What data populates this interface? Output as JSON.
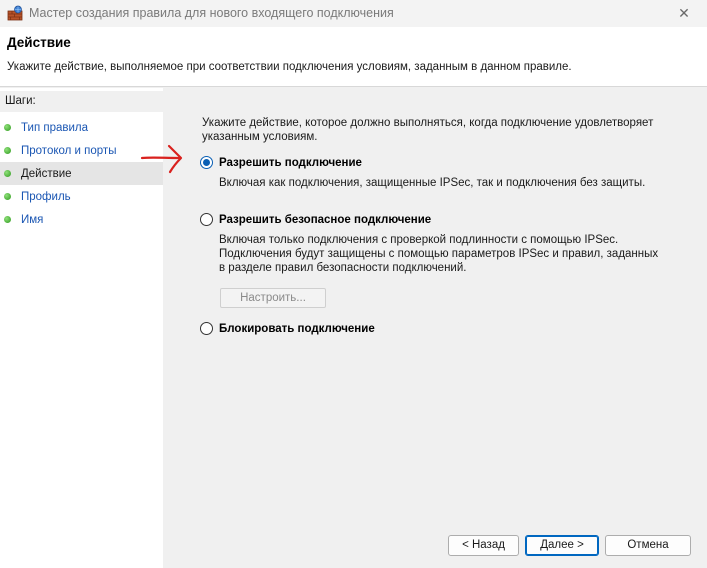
{
  "window": {
    "title": "Мастер создания правила для нового входящего подключения",
    "close_glyph": "✕"
  },
  "header": {
    "title": "Действие",
    "description": "Укажите действие, выполняемое при соответствии подключения условиям, заданным в данном правиле."
  },
  "sidebar": {
    "heading": "Шаги:",
    "steps": [
      {
        "label": "Тип правила",
        "active": false
      },
      {
        "label": "Протокол и порты",
        "active": false
      },
      {
        "label": "Действие",
        "active": true
      },
      {
        "label": "Профиль",
        "active": false
      },
      {
        "label": "Имя",
        "active": false
      }
    ]
  },
  "main": {
    "intro": "Укажите действие, которое должно выполняться, когда подключение удовлетворяет указанным условиям.",
    "options": [
      {
        "label": "Разрешить подключение",
        "description": "Включая как подключения, защищенные IPSec, так и подключения без защиты.",
        "selected": true
      },
      {
        "label": "Разрешить безопасное подключение",
        "description": "Включая только подключения с проверкой подлинности с помощью IPSec. Подключения будут защищены с помощью параметров IPSec и правил, заданных в разделе правил безопасности подключений.",
        "selected": false
      },
      {
        "label": "Блокировать подключение",
        "description": "",
        "selected": false
      }
    ],
    "configure_button": "Настроить..."
  },
  "footer": {
    "back_label": "< Назад",
    "next_label": "Далее >",
    "cancel_label": "Отмена"
  },
  "colors": {
    "accent": "#0a5fb4",
    "link": "#1a56b3",
    "annotation_arrow": "#d9211e"
  },
  "icons": {
    "app": "firewall-icon",
    "step_bullet": "green-dot-icon",
    "annotation": "red-arrow-icon"
  }
}
